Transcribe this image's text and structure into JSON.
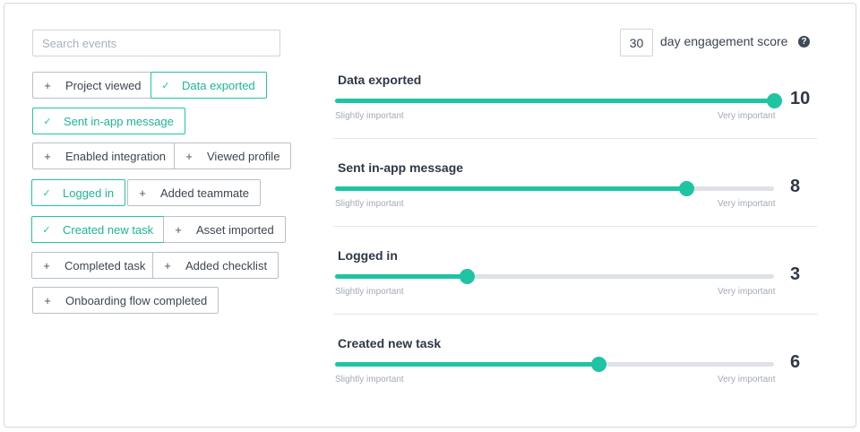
{
  "search": {
    "placeholder": "Search events"
  },
  "events": [
    {
      "label": "Project viewed",
      "selected": false
    },
    {
      "label": "Data exported",
      "selected": true
    },
    {
      "label": "Sent in-app message",
      "selected": true
    },
    {
      "label": "Enabled integration",
      "selected": false
    },
    {
      "label": "Viewed profile",
      "selected": false
    },
    {
      "label": "Logged in",
      "selected": true
    },
    {
      "label": "Added teammate",
      "selected": false
    },
    {
      "label": "Created new task",
      "selected": true
    },
    {
      "label": "Asset imported",
      "selected": false
    },
    {
      "label": "Completed task",
      "selected": false
    },
    {
      "label": "Added checklist",
      "selected": false
    },
    {
      "label": "Onboarding flow completed",
      "selected": false
    }
  ],
  "engagement": {
    "days": "30",
    "label": "day engagement score",
    "help_icon": "?"
  },
  "sliders": [
    {
      "title": "Data exported",
      "value": 10,
      "value_label": "10",
      "min": 0,
      "max": 10,
      "low_label": "Slightly important",
      "high_label": "Very important"
    },
    {
      "title": "Sent in-app message",
      "value": 8,
      "value_label": "8",
      "min": 0,
      "max": 10,
      "low_label": "Slightly important",
      "high_label": "Very important"
    },
    {
      "title": "Logged in",
      "value": 3,
      "value_label": "3",
      "min": 0,
      "max": 10,
      "low_label": "Slightly important",
      "high_label": "Very important"
    },
    {
      "title": "Created new task",
      "value": 6,
      "value_label": "6",
      "min": 0,
      "max": 10,
      "low_label": "Slightly important",
      "high_label": "Very important"
    }
  ],
  "colors": {
    "accent": "#1fc4a2",
    "track": "#dfe2e5",
    "text": "#2f3845",
    "muted": "#a3abb4"
  },
  "icons": {
    "add": "plus-icon",
    "selected": "check-icon",
    "help": "help-icon"
  }
}
